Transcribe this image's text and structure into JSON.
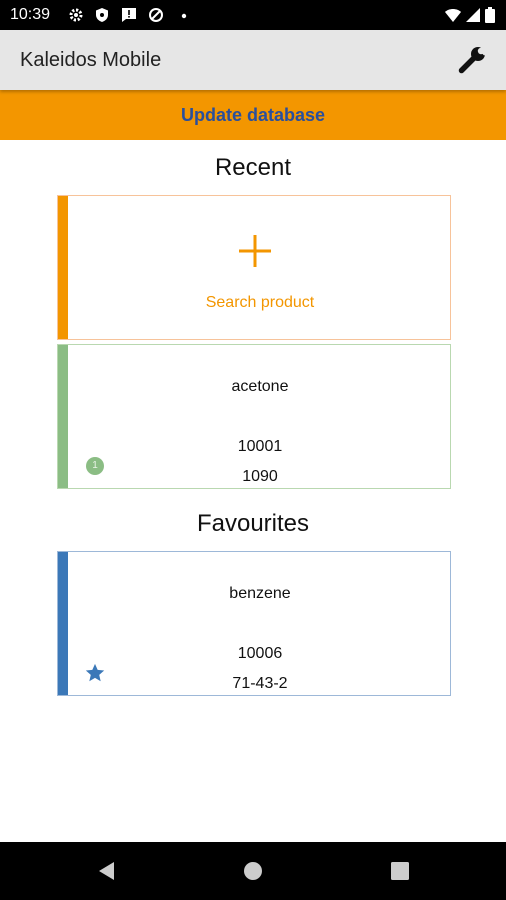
{
  "status_bar": {
    "time": "10:39",
    "icons": [
      "settings-gear-icon",
      "shield-icon",
      "message-icon",
      "data-saver-icon",
      "dot-icon",
      "wifi-icon",
      "signal-icon",
      "battery-icon"
    ]
  },
  "app_bar": {
    "title": "Kaleidos Mobile",
    "settings_icon": "wrench-icon"
  },
  "update_button": {
    "label": "Update database"
  },
  "recent": {
    "heading": "Recent",
    "search_card": {
      "icon": "plus-icon",
      "label": "Search product"
    },
    "items": [
      {
        "name": "acetone",
        "code": "10001",
        "number": "1090",
        "badge": "1"
      }
    ]
  },
  "favourites": {
    "heading": "Favourites",
    "items": [
      {
        "name": "benzene",
        "code": "10006",
        "number": "71-43-2",
        "icon": "star-icon"
      }
    ]
  },
  "nav_bar": {
    "icons": [
      "back-icon",
      "home-icon",
      "recents-icon"
    ]
  },
  "colors": {
    "accent_orange": "#f39600",
    "title_blue": "#2a4f9c",
    "recent_green": "#8bbd84",
    "favourite_blue": "#3b78b8"
  }
}
